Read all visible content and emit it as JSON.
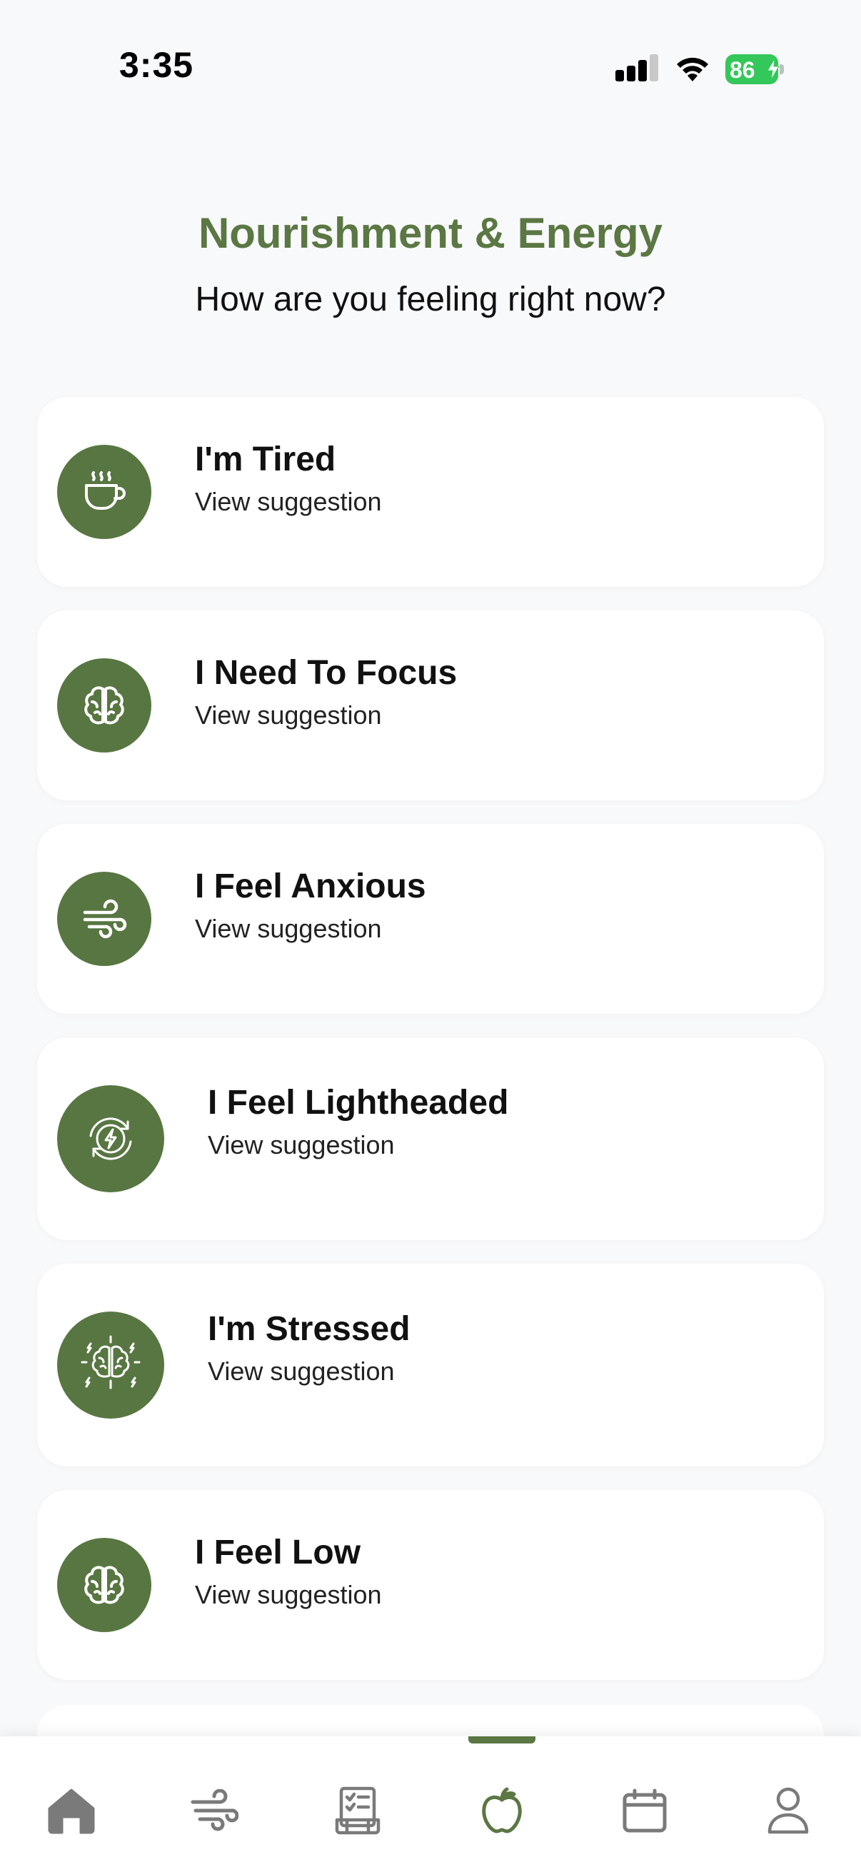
{
  "status_bar": {
    "time": "3:35",
    "battery_level": "86",
    "icons": [
      "signal-icon",
      "wifi-icon",
      "battery-icon"
    ]
  },
  "header": {
    "title": "Nourishment & Energy",
    "subtitle": "How are you feeling right now?"
  },
  "moods": [
    {
      "label": "I'm Tired",
      "action": "View suggestion",
      "icon": "coffee-cup-icon"
    },
    {
      "label": "I Need To Focus",
      "action": "View suggestion",
      "icon": "brain-icon"
    },
    {
      "label": "I Feel Anxious",
      "action": "View suggestion",
      "icon": "wind-icon"
    },
    {
      "label": "I Feel Lightheaded",
      "action": "View suggestion",
      "icon": "energy-cycle-icon"
    },
    {
      "label": "I'm Stressed",
      "action": "View suggestion",
      "icon": "brain-sparks-icon"
    },
    {
      "label": "I Feel Low",
      "action": "View suggestion",
      "icon": "brain-icon"
    }
  ],
  "bottom_nav": {
    "items": [
      "home-icon",
      "breath-wind-icon",
      "checklist-icon",
      "apple-icon",
      "calendar-icon",
      "profile-icon"
    ],
    "active": "apple-icon"
  },
  "colors": {
    "accent": "#5b7744",
    "icon_circle": "#587642",
    "background": "#f8f9fa",
    "card": "#ffffff",
    "nav_inactive": "#7a7a7a",
    "battery": "#34c759"
  }
}
